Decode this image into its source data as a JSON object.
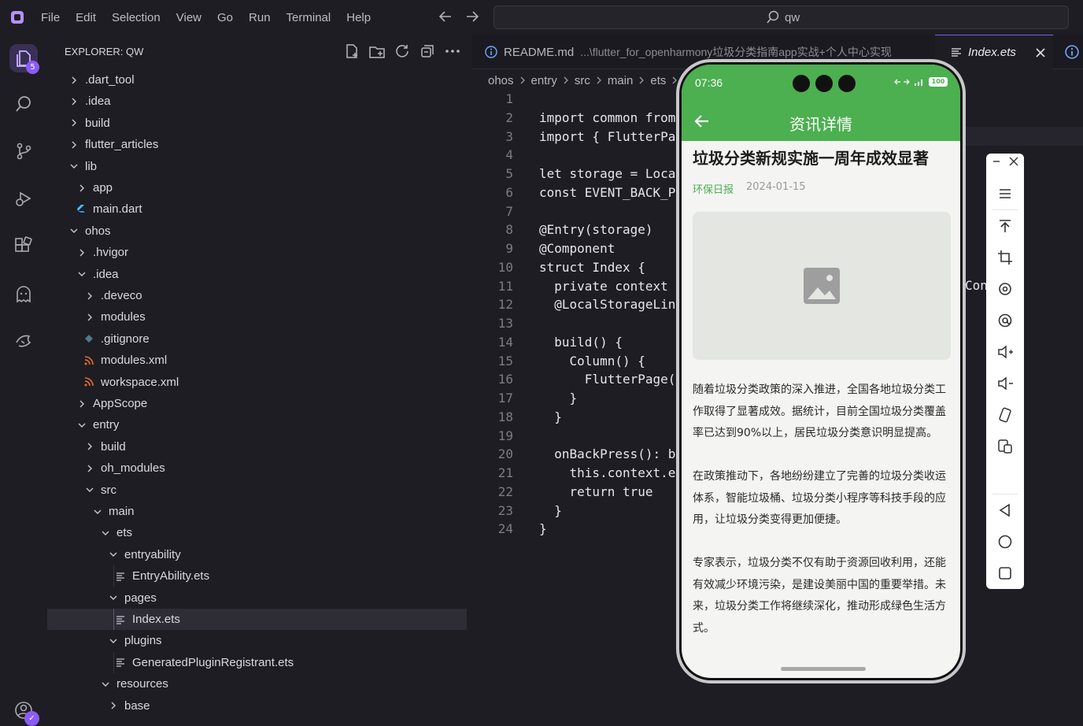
{
  "menubar": {
    "items": [
      "File",
      "Edit",
      "Selection",
      "View",
      "Go",
      "Run",
      "Terminal",
      "Help"
    ]
  },
  "command_center": {
    "text": "qw"
  },
  "activity": {
    "badge": "5"
  },
  "explorer": {
    "header": "EXPLORER: QW",
    "tree": [
      {
        "label": ".dart_tool",
        "kind": "folder",
        "depth": 0,
        "open": false
      },
      {
        "label": ".idea",
        "kind": "folder",
        "depth": 0,
        "open": false
      },
      {
        "label": "build",
        "kind": "folder",
        "depth": 0,
        "open": false
      },
      {
        "label": "flutter_articles",
        "kind": "folder",
        "depth": 0,
        "open": false
      },
      {
        "label": "lib",
        "kind": "folder",
        "depth": 0,
        "open": true
      },
      {
        "label": "app",
        "kind": "folder",
        "depth": 1,
        "open": false
      },
      {
        "label": "main.dart",
        "kind": "dart",
        "depth": 1
      },
      {
        "label": "ohos",
        "kind": "folder",
        "depth": 0,
        "open": true
      },
      {
        "label": ".hvigor",
        "kind": "folder",
        "depth": 1,
        "open": false
      },
      {
        "label": ".idea",
        "kind": "folder",
        "depth": 1,
        "open": true
      },
      {
        "label": ".deveco",
        "kind": "folder",
        "depth": 2,
        "open": false
      },
      {
        "label": "modules",
        "kind": "folder",
        "depth": 2,
        "open": false
      },
      {
        "label": ".gitignore",
        "kind": "git",
        "depth": 2
      },
      {
        "label": "modules.xml",
        "kind": "xml",
        "depth": 2
      },
      {
        "label": "workspace.xml",
        "kind": "xml",
        "depth": 2
      },
      {
        "label": "AppScope",
        "kind": "folder",
        "depth": 1,
        "open": false
      },
      {
        "label": "entry",
        "kind": "folder",
        "depth": 1,
        "open": true
      },
      {
        "label": "build",
        "kind": "folder",
        "depth": 2,
        "open": false
      },
      {
        "label": "oh_modules",
        "kind": "folder",
        "depth": 2,
        "open": false
      },
      {
        "label": "src",
        "kind": "folder",
        "depth": 2,
        "open": true
      },
      {
        "label": "main",
        "kind": "folder",
        "depth": 3,
        "open": true
      },
      {
        "label": "ets",
        "kind": "folder",
        "depth": 4,
        "open": true
      },
      {
        "label": "entryability",
        "kind": "folder",
        "depth": 5,
        "open": true
      },
      {
        "label": "EntryAbility.ets",
        "kind": "ets",
        "depth": 6
      },
      {
        "label": "pages",
        "kind": "folder",
        "depth": 5,
        "open": true
      },
      {
        "label": "Index.ets",
        "kind": "ets",
        "depth": 6,
        "selected": true
      },
      {
        "label": "plugins",
        "kind": "folder",
        "depth": 5,
        "open": true
      },
      {
        "label": "GeneratedPluginRegistrant.ets",
        "kind": "ets",
        "depth": 6
      },
      {
        "label": "resources",
        "kind": "folder",
        "depth": 4,
        "open": true
      },
      {
        "label": "base",
        "kind": "folder",
        "depth": 5,
        "open": false
      }
    ]
  },
  "tabs": {
    "readme": {
      "name": "README.md",
      "path": "...\\flutter_for_openharmony垃圾分类指南app实战+个人中心实现"
    },
    "index": {
      "name": "Index.ets"
    }
  },
  "breadcrumb": [
    "ohos",
    "entry",
    "src",
    "main",
    "ets"
  ],
  "code": {
    "lines": [
      "",
      "import common from",
      "import { FlutterPa",
      "",
      "let storage = Loca",
      "const EVENT_BACK_P",
      "",
      "@Entry(storage)",
      "@Component",
      "struct Index {",
      "  private context",
      "  @LocalStorageLin",
      "",
      "  build() {",
      "    Column() {",
      "      FlutterPage(",
      "    }",
      "  }",
      "",
      "  onBackPress(): b",
      "    this.context.e",
      "    return true",
      "  }",
      "}"
    ],
    "peek": "Con"
  },
  "phone": {
    "clock": "07:36",
    "battery": "100",
    "page_title": "资讯详情",
    "article_title": "垃圾分类新规实施一周年成效显著",
    "source": "环保日报",
    "date": "2024-01-15",
    "paragraphs": [
      "随着垃圾分类政策的深入推进，全国各地垃圾分类工作取得了显著成效。据统计，目前全国垃圾分类覆盖率已达到90%以上，居民垃圾分类意识明显提高。",
      "在政策推动下，各地纷纷建立了完善的垃圾分类收运体系，智能垃圾桶、垃圾分类小程序等科技手段的应用，让垃圾分类变得更加便捷。",
      "专家表示，垃圾分类不仅有助于资源回收利用，还能有效减少环境污染，是建设美丽中国的重要举措。未来，垃圾分类工作将继续深化，推动形成绿色生活方式。"
    ]
  },
  "colors": {
    "accent": "#7f5af0",
    "appbar_green": "#4caf50",
    "background": "#1e1d23"
  }
}
